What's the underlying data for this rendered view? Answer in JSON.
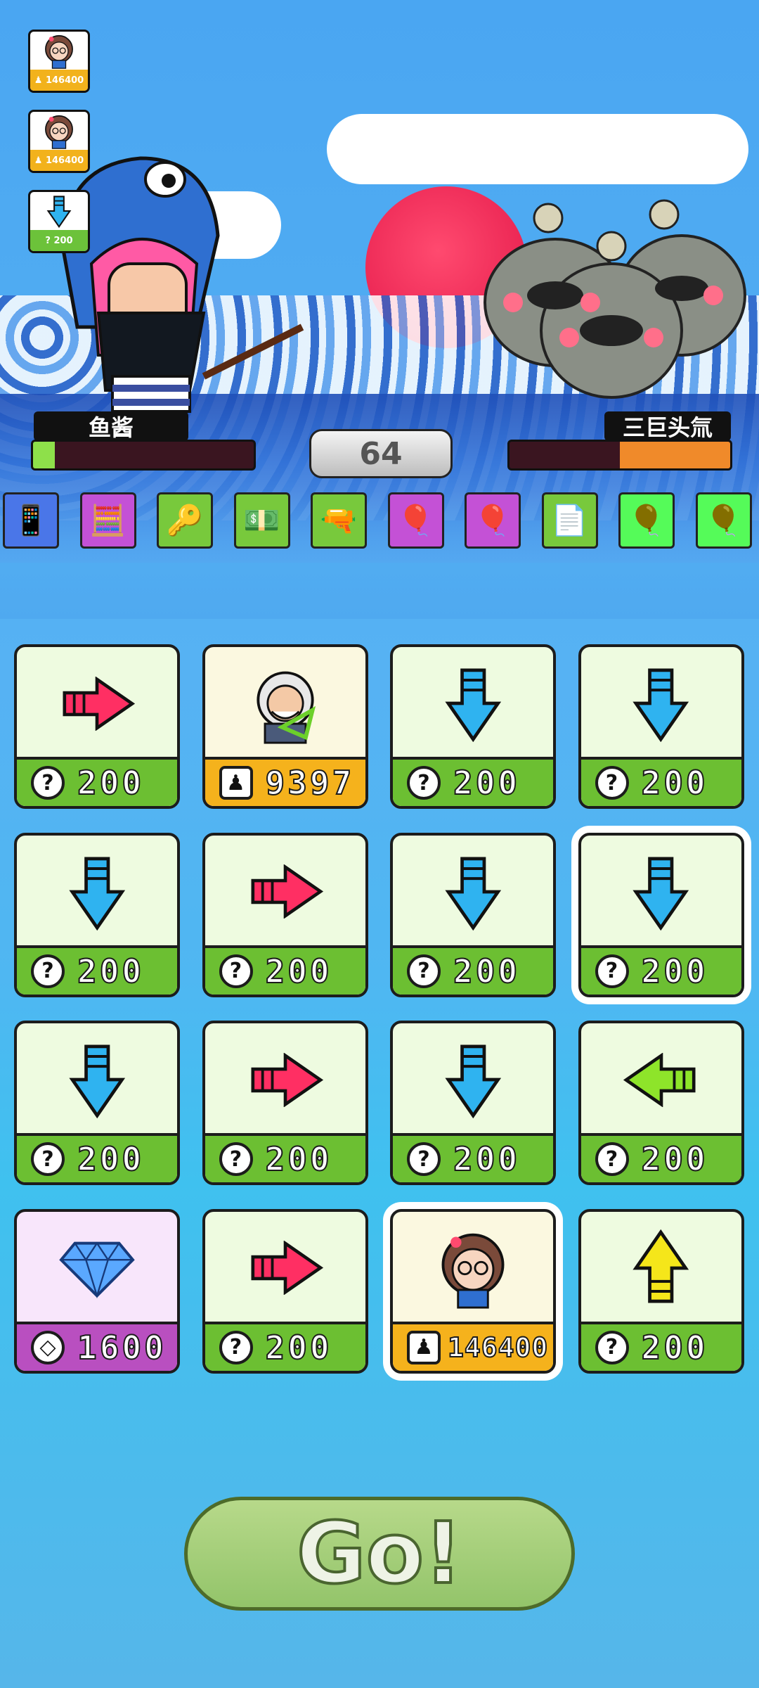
{
  "sidebar": {
    "cards": [
      {
        "icon": "girl-portrait-icon",
        "value": "146400"
      },
      {
        "icon": "girl-portrait-icon",
        "value": "146400"
      },
      {
        "icon": "down-arrow-icon",
        "value": "200"
      }
    ]
  },
  "player": {
    "name": "鱼酱",
    "hp_fraction": 0.1,
    "hp_color": "#8ee04a"
  },
  "enemy": {
    "name": "三巨头氚",
    "hp_fraction": 0.5,
    "hp_color": "#f08a2a"
  },
  "turn": {
    "value": "64"
  },
  "items": [
    {
      "icon": "phone-item-icon",
      "color": "#4a76e8"
    },
    {
      "icon": "calculator-item-icon",
      "color": "#c451d6"
    },
    {
      "icon": "key-item-icon",
      "color": "#78c93c"
    },
    {
      "icon": "money-item-icon",
      "color": "#78c93c"
    },
    {
      "icon": "gun-item-icon",
      "color": "#78c93c"
    },
    {
      "icon": "purple-balloon-icon",
      "color": "#c451d6"
    },
    {
      "icon": "purple-balloon-icon",
      "color": "#c451d6"
    },
    {
      "icon": "paper-item-icon",
      "color": "#78c93c"
    },
    {
      "icon": "yellow-balloon-icon",
      "color": "#f4d02c"
    },
    {
      "icon": "yellow-balloon-icon",
      "color": "#f4d02c"
    }
  ],
  "cards": [
    {
      "art": "right-arrow-icon",
      "price": "200",
      "cost_icon": "?",
      "theme": "green"
    },
    {
      "art": "einstein-portrait-icon",
      "price": "9397",
      "cost_icon": "person",
      "theme": "gold"
    },
    {
      "art": "down-arrow-icon",
      "price": "200",
      "cost_icon": "?",
      "theme": "green"
    },
    {
      "art": "down-arrow-icon",
      "price": "200",
      "cost_icon": "?",
      "theme": "green"
    },
    {
      "art": "down-arrow-icon",
      "price": "200",
      "cost_icon": "?",
      "theme": "green"
    },
    {
      "art": "right-arrow-icon",
      "price": "200",
      "cost_icon": "?",
      "theme": "green"
    },
    {
      "art": "down-arrow-icon",
      "price": "200",
      "cost_icon": "?",
      "theme": "green"
    },
    {
      "art": "down-arrow-icon",
      "price": "200",
      "cost_icon": "?",
      "theme": "green",
      "selected": true
    },
    {
      "art": "down-arrow-icon",
      "price": "200",
      "cost_icon": "?",
      "theme": "green"
    },
    {
      "art": "right-arrow-icon",
      "price": "200",
      "cost_icon": "?",
      "theme": "green"
    },
    {
      "art": "down-arrow-icon",
      "price": "200",
      "cost_icon": "?",
      "theme": "green"
    },
    {
      "art": "left-arrow-icon",
      "price": "200",
      "cost_icon": "?",
      "theme": "green"
    },
    {
      "art": "diamond-icon",
      "price": "1600",
      "cost_icon": "diamond",
      "theme": "purple"
    },
    {
      "art": "right-arrow-icon",
      "price": "200",
      "cost_icon": "?",
      "theme": "green"
    },
    {
      "art": "girl-portrait-icon",
      "price": "146400",
      "cost_icon": "person",
      "theme": "gold",
      "selected": true
    },
    {
      "art": "up-arrow-icon",
      "price": "200",
      "cost_icon": "?",
      "theme": "green"
    }
  ],
  "go_button": {
    "label": "Go!"
  }
}
